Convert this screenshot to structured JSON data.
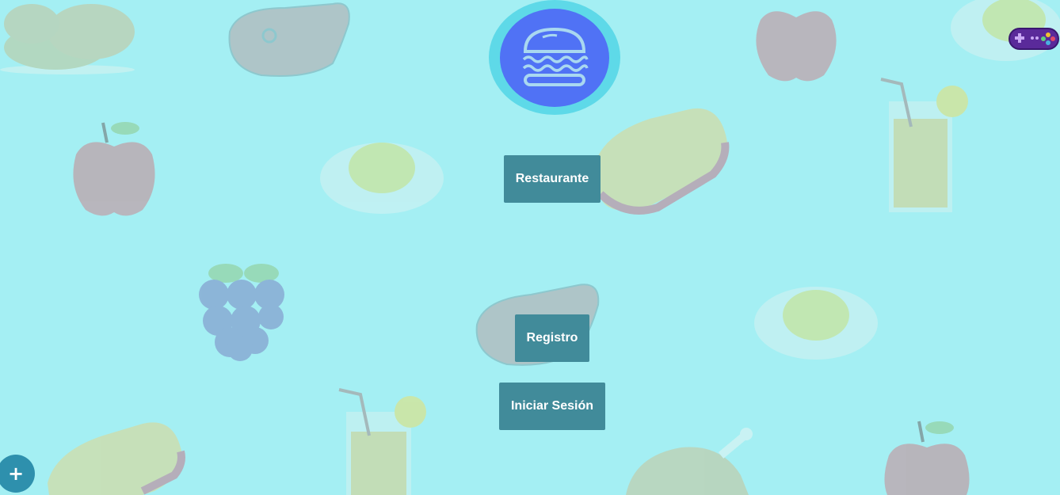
{
  "app": {
    "logo_icon": "burger-icon",
    "colors": {
      "background": "#a4eff3",
      "logo_ring": "#5ed9e8",
      "logo_fill": "#5072f5",
      "button": "#418b9a",
      "fab": "#2e90ad"
    }
  },
  "buttons": {
    "restaurante": "Restaurante",
    "registro": "Registro",
    "login": "Iniciar Sesión"
  },
  "fab": {
    "label": "+",
    "icon": "plus-icon"
  },
  "extension_icon": "gamepad-icon",
  "background_icons": [
    "chicken-icon",
    "steak-icon",
    "apple-icon",
    "egg-icon",
    "sandwich-icon",
    "juice-icon",
    "grapes-icon",
    "chicken-leg-icon"
  ]
}
